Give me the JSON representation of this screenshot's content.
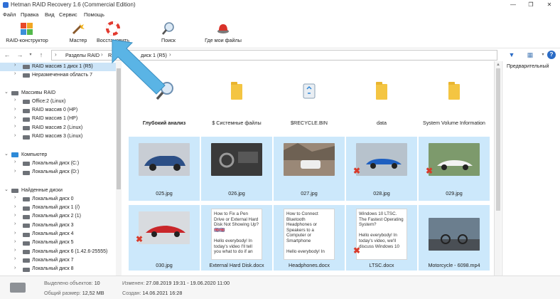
{
  "window": {
    "title": "Hetman RAID Recovery 1.6 (Commercial Edition)",
    "controls": [
      "minimize-icon",
      "maximize-icon",
      "close-icon"
    ]
  },
  "menu": [
    "Файл",
    "Правка",
    "Вид",
    "Сервис",
    "Помощь"
  ],
  "toolbar": {
    "raid_constructor": "RAID-конструктор",
    "wizard": "Мастер",
    "restore": "Восстановить",
    "search": "Поиск",
    "where_files": "Где мои файлы"
  },
  "breadcrumb": {
    "items": [
      "Разделы RAID",
      "RA",
      "диск 1 (R5)"
    ]
  },
  "tree": [
    {
      "label": "RAID массив 1 диск 1 (R5)",
      "selected": true
    },
    {
      "label": "Неразмеченная область 7"
    },
    {
      "label": "Массивы RAID"
    },
    {
      "label": "Office:2 (Linux)"
    },
    {
      "label": "RAID массив 0 (HP)"
    },
    {
      "label": "RAID массив 1 (HP)"
    },
    {
      "label": "RAID массив 2 (Linux)"
    },
    {
      "label": "RAID массив 3 (Linux)"
    },
    {
      "label": "Компьютер"
    },
    {
      "label": "Локальный диск (C:)"
    },
    {
      "label": "Локальный диск (D:)"
    },
    {
      "label": "Найденные диски"
    },
    {
      "label": "Локальный диск 0"
    },
    {
      "label": "Локальный диск 1 (/)"
    },
    {
      "label": "Локальный диск 2 (1)"
    },
    {
      "label": "Локальный диск 3"
    },
    {
      "label": "Локальный диск 4"
    },
    {
      "label": "Локальный диск 5"
    },
    {
      "label": "Локальный диск 6 (1.42.6-25555)"
    },
    {
      "label": "Локальный диск 7"
    },
    {
      "label": "Локальный диск 8"
    }
  ],
  "files": {
    "row1": [
      "Глубокий анализ",
      "$ Системные файлы",
      "$RECYCLE.BIN",
      "data",
      "System Volume Information"
    ],
    "row2": [
      "025.jpg",
      "026.jpg",
      "027.jpg",
      "028.jpg",
      "029.jpg"
    ],
    "row3": [
      "030.jpg",
      "External Hard Disk.docx",
      "Headphones.docx",
      "LTSC.docx",
      "Motorcycle - 6098.mp4"
    ],
    "doc_previews": [
      "How to Fix a Pen Drive or External Hard Disk Not Showing Up? 🇬🇧🇬🇧\n\nHello everybody! In today's video I'll tell you what to do if an",
      "How to Connect Bluetooth Headphones or Speakers to a Computer or Smartphone\n\nHello everybody! In",
      "Windows 10 LTSC. The Fastest Operating System?\n\nHello everybody! In today's video, we'll discuss Windows 10"
    ]
  },
  "preview": {
    "header": "Предварительный"
  },
  "status": {
    "selected_label": "Выделено объектов:",
    "selected_value": "10",
    "size_label": "Общий размер:",
    "size_value": "12,52 MB",
    "modified_label": "Изменен:",
    "modified_value": "27.08.2019 19:31 - 19.06.2020 11:00",
    "created_label": "Создан:",
    "created_value": "14.06.2021 16:28"
  },
  "colors": {
    "selection": "#cce8fb",
    "callout_arrow": "#5ab4e5",
    "folder": "#f4c542",
    "deleted_mark": "#d83a2b"
  }
}
